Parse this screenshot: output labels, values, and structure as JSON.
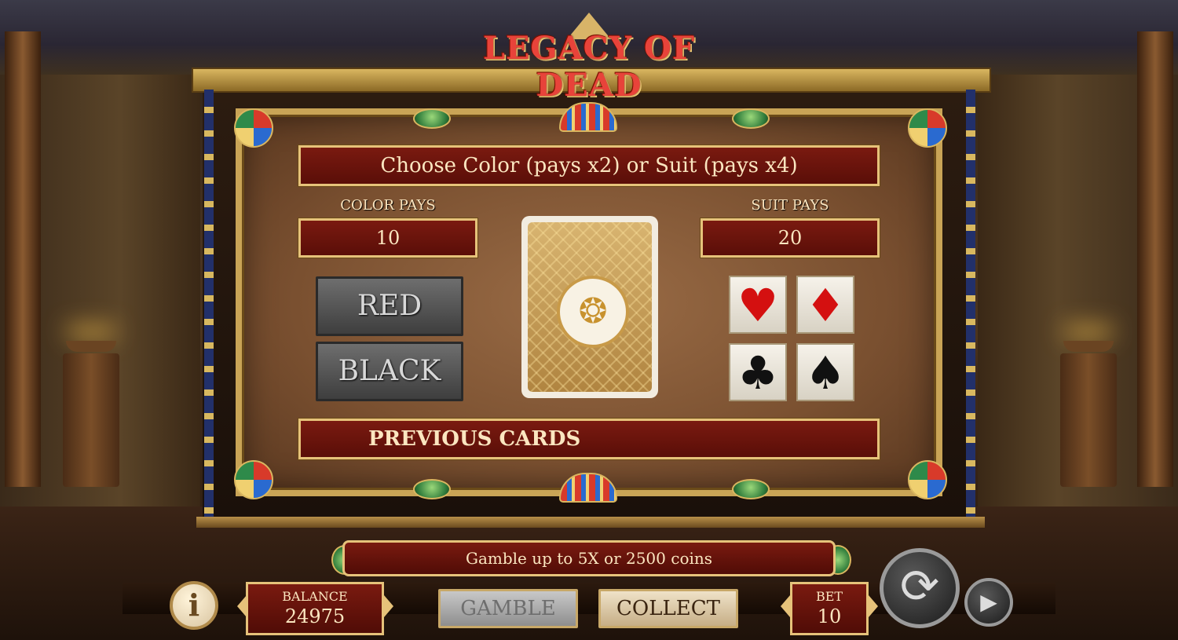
{
  "game": {
    "title": "LEGACY OF DEAD"
  },
  "gamble_panel": {
    "instruction": "Choose Color (pays x2) or Suit (pays x4)",
    "color_pays_label": "COLOR PAYS",
    "color_pays_value": "10",
    "suit_pays_label": "SUIT PAYS",
    "suit_pays_value": "20",
    "red_label": "RED",
    "black_label": "BLACK",
    "card_icon": "scarab-icon",
    "suits": [
      {
        "name": "hearts",
        "glyph": "♥",
        "color": "#d41010"
      },
      {
        "name": "diamonds",
        "glyph": "♦",
        "color": "#d41010"
      },
      {
        "name": "clubs",
        "glyph": "♣",
        "color": "#111111"
      },
      {
        "name": "spades",
        "glyph": "♠",
        "color": "#111111"
      }
    ],
    "previous_cards_label": "PREVIOUS CARDS"
  },
  "footer": {
    "info_text": "Gamble up to 5X or 2500 coins",
    "info_icon_glyph": "i",
    "balance_label": "BALANCE",
    "balance_value": "24975",
    "gamble_label": "GAMBLE",
    "collect_label": "COLLECT",
    "bet_label": "BET",
    "bet_value": "10",
    "spin_icon": "spin-icon",
    "autoplay_icon": "autoplay-icon"
  },
  "colors": {
    "accent_gold": "#e6c27a",
    "bar_red": "#7a1a10",
    "text_cream": "#fbe6c0"
  }
}
